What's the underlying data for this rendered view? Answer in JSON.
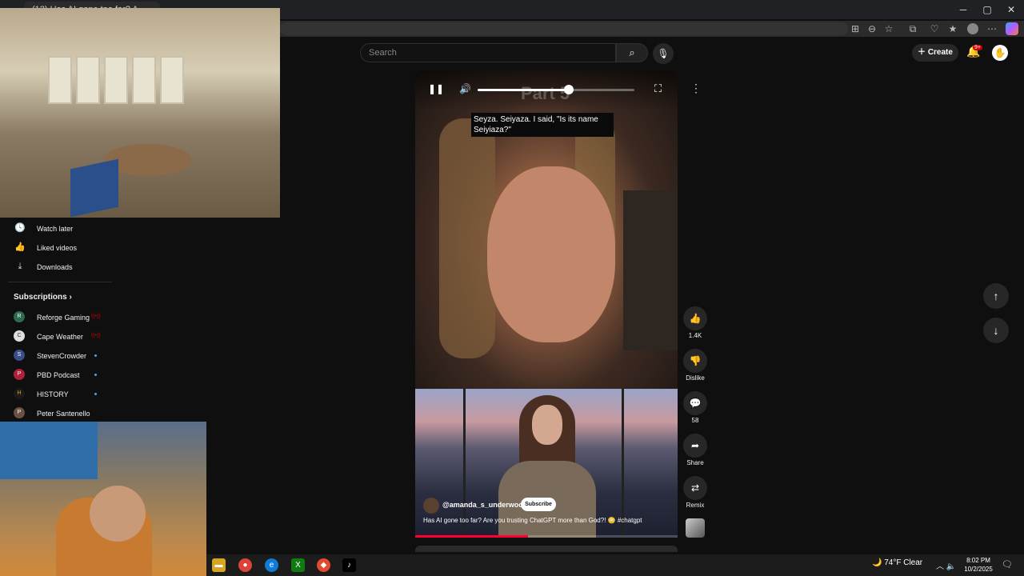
{
  "browser": {
    "tab_title": "(12) Has AI gone too far? A",
    "window_controls": {
      "minimize": "─",
      "maximize": "▢",
      "close": "✕"
    },
    "toolbar_icons": [
      "apps-icon",
      "zoom-icon",
      "favorite-star-icon",
      "extensions-icon",
      "browser-essentials-icon",
      "favorites-icon",
      "profile-icon",
      "more-icon",
      "copilot-icon"
    ]
  },
  "header": {
    "search_placeholder": "Search",
    "create_label": "Create",
    "notification_badge": "9+"
  },
  "sidebar": {
    "items": [
      {
        "label": "Watch later",
        "icon": "clock-icon",
        "glyph": "🕓"
      },
      {
        "label": "Liked videos",
        "icon": "thumbs-up-icon",
        "glyph": "👍"
      },
      {
        "label": "Downloads",
        "icon": "download-icon",
        "glyph": "⤓"
      }
    ],
    "subscriptions_heading": "Subscriptions",
    "subscriptions": [
      {
        "label": "Reforge Gaming",
        "indicator": "live",
        "avatar_color": "#2d6a4f",
        "avatar_text": "R"
      },
      {
        "label": "Cape Weather",
        "indicator": "live",
        "avatar_color": "#e0e0e0",
        "avatar_text": "C"
      },
      {
        "label": "StevenCrowder",
        "indicator": "dot",
        "avatar_color": "#3a4f8a",
        "avatar_text": "S"
      },
      {
        "label": "PBD Podcast",
        "indicator": "dot",
        "avatar_color": "#b0203a",
        "avatar_text": "P"
      },
      {
        "label": "HISTORY",
        "indicator": "dot",
        "avatar_color": "#1a1a1a",
        "avatar_text": "H"
      },
      {
        "label": "Peter Santenello",
        "indicator": "none",
        "avatar_color": "#6a5040",
        "avatar_text": "P"
      }
    ]
  },
  "player": {
    "volume": 0.58,
    "overlay_text": "Part 5",
    "caption": "Seyza. Seiyaza. I said, \"Is its name Seiyiaza?\""
  },
  "actions": {
    "like_count": "1.4K",
    "dislike_label": "Dislike",
    "comment_count": "58",
    "share_label": "Share",
    "remix_label": "Remix"
  },
  "next_short": {
    "channel": "@amanda_s_underwood",
    "subscribe_label": "Subscribe",
    "title": "Has AI gone too far? Are you trusting ChatGPT more than God?! 😳 #chatgpt",
    "progress": 0.43
  },
  "taskbar": {
    "weather_icon": "🌙",
    "weather": "74°F  Clear",
    "time": "8:02 PM",
    "date": "10/2/2025"
  },
  "colors": {
    "background": "#0f0f0f",
    "accent_red": "#cc0000",
    "progress_red": "#ff0033"
  }
}
